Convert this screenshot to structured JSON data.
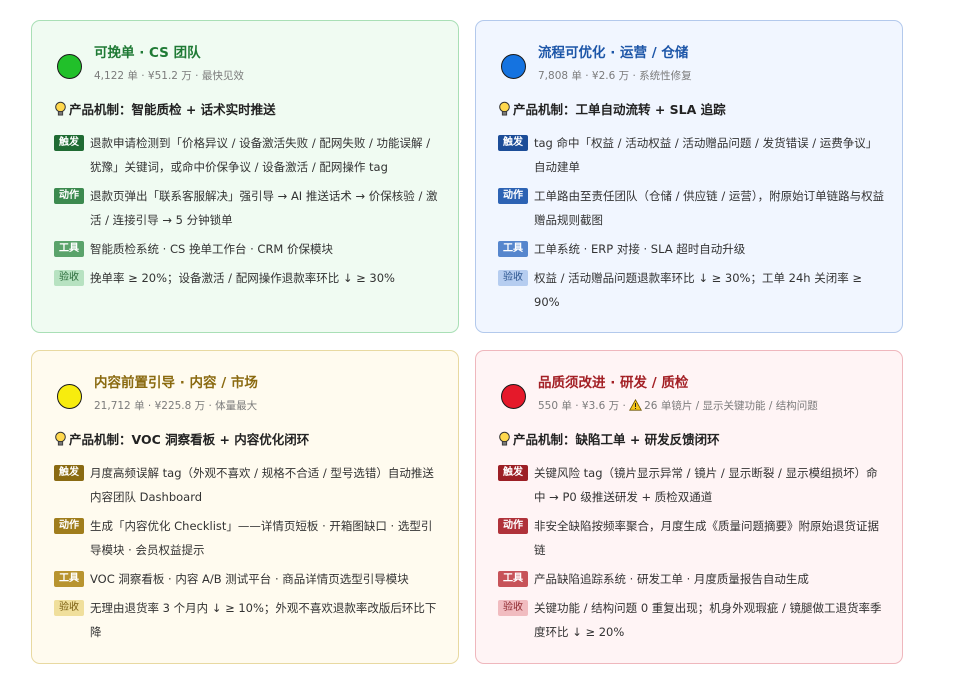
{
  "cards": [
    {
      "title": "可挽单 · CS 团队",
      "subtitle": "4,122 单 · ¥51.2 万 · 最快见效",
      "dot_color": "#21c02a",
      "mechanism": "产品机制：智能质检 + 话术实时推送",
      "rows": [
        {
          "tag": "触发",
          "text": "退款申请检测到「价格异议 / 设备激活失败 / 配网失败 / 功能误解 / 犹豫」关键词，或命中价保争议 / 设备激活 / 配网操作 tag"
        },
        {
          "tag": "动作",
          "text": "退款页弹出「联系客服解决」强引导 → AI 推送话术 → 价保核验 / 激活 / 连接引导 → 5 分钟锁单"
        },
        {
          "tag": "工具",
          "text": "智能质检系统 · CS 挽单工作台 · CRM 价保模块"
        },
        {
          "tag": "验收",
          "text": "挽单率 ≥ 20%；设备激活 / 配网操作退款率环比 ↓ ≥ 30%"
        }
      ]
    },
    {
      "title": "流程可优化 · 运营 / 仓储",
      "subtitle": "7,808 单 · ¥2.6 万 · 系统性修复",
      "dot_color": "#1573e0",
      "mechanism": "产品机制：工单自动流转 + SLA 追踪",
      "rows": [
        {
          "tag": "触发",
          "text": "tag 命中「权益 / 活动权益 / 活动赠品问题 / 发货错误 / 运费争议」自动建单"
        },
        {
          "tag": "动作",
          "text": "工单路由至责任团队（仓储 / 供应链 / 运营），附原始订单链路与权益赠品规则截图"
        },
        {
          "tag": "工具",
          "text": "工单系统 · ERP 对接 · SLA 超时自动升级"
        },
        {
          "tag": "验收",
          "text": "权益 / 活动赠品问题退款率环比 ↓ ≥ 30%；工单 24h 关闭率 ≥ 90%"
        }
      ]
    },
    {
      "title": "内容前置引导 · 内容 / 市场",
      "subtitle": "21,712 单 · ¥225.8 万 · 体量最大",
      "dot_color": "#f7ec0e",
      "mechanism": "产品机制：VOC 洞察看板 + 内容优化闭环",
      "rows": [
        {
          "tag": "触发",
          "text": "月度高频误解 tag（外观不喜欢 / 规格不合适 / 型号选错）自动推送内容团队 Dashboard"
        },
        {
          "tag": "动作",
          "text": "生成「内容优化 Checklist」——详情页短板 · 开箱图缺口 · 选型引导模块 · 会员权益提示"
        },
        {
          "tag": "工具",
          "text": "VOC 洞察看板 · 内容 A/B 测试平台 · 商品详情页选型引导模块"
        },
        {
          "tag": "验收",
          "text": "无理由退货率 3 个月内 ↓ ≥ 10%；外观不喜欢退款率改版后环比下降"
        }
      ]
    },
    {
      "title": "品质须改进 · 研发 / 质检",
      "subtitle_prefix": "550 单 · ¥3.6 万 · ",
      "subtitle_suffix": "26 单镜片 / 显示关键功能 / 结构问题",
      "warn_icon": "warning-icon",
      "dot_color": "#e5192a",
      "mechanism": "产品机制：缺陷工单 + 研发反馈闭环",
      "rows": [
        {
          "tag": "触发",
          "text": "关键风险 tag（镜片显示异常 / 镜片 / 显示断裂 / 显示模组损坏）命中 → P0 级推送研发 + 质检双通道"
        },
        {
          "tag": "动作",
          "text": "非安全缺陷按频率聚合，月度生成《质量问题摘要》附原始退货证据链"
        },
        {
          "tag": "工具",
          "text": "产品缺陷追踪系统 · 研发工单 · 月度质量报告自动生成"
        },
        {
          "tag": "验收",
          "text": "关键功能 / 结构问题 0 重复出现；机身外观瑕疵 / 镜腿做工退货率季度环比 ↓ ≥ 20%"
        }
      ]
    }
  ]
}
